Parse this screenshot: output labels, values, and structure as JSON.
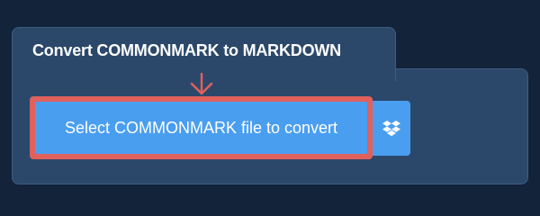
{
  "panel": {
    "title": "Convert COMMONMARK to MARKDOWN"
  },
  "upload": {
    "button_label": "Select COMMONMARK file to convert",
    "dropbox_icon": "dropbox-icon",
    "arrow_icon": "arrow-down-icon"
  },
  "colors": {
    "background": "#13233a",
    "panel": "#2b486a",
    "button": "#4a9ef0",
    "highlight": "#e0605c",
    "text": "#ffffff"
  }
}
